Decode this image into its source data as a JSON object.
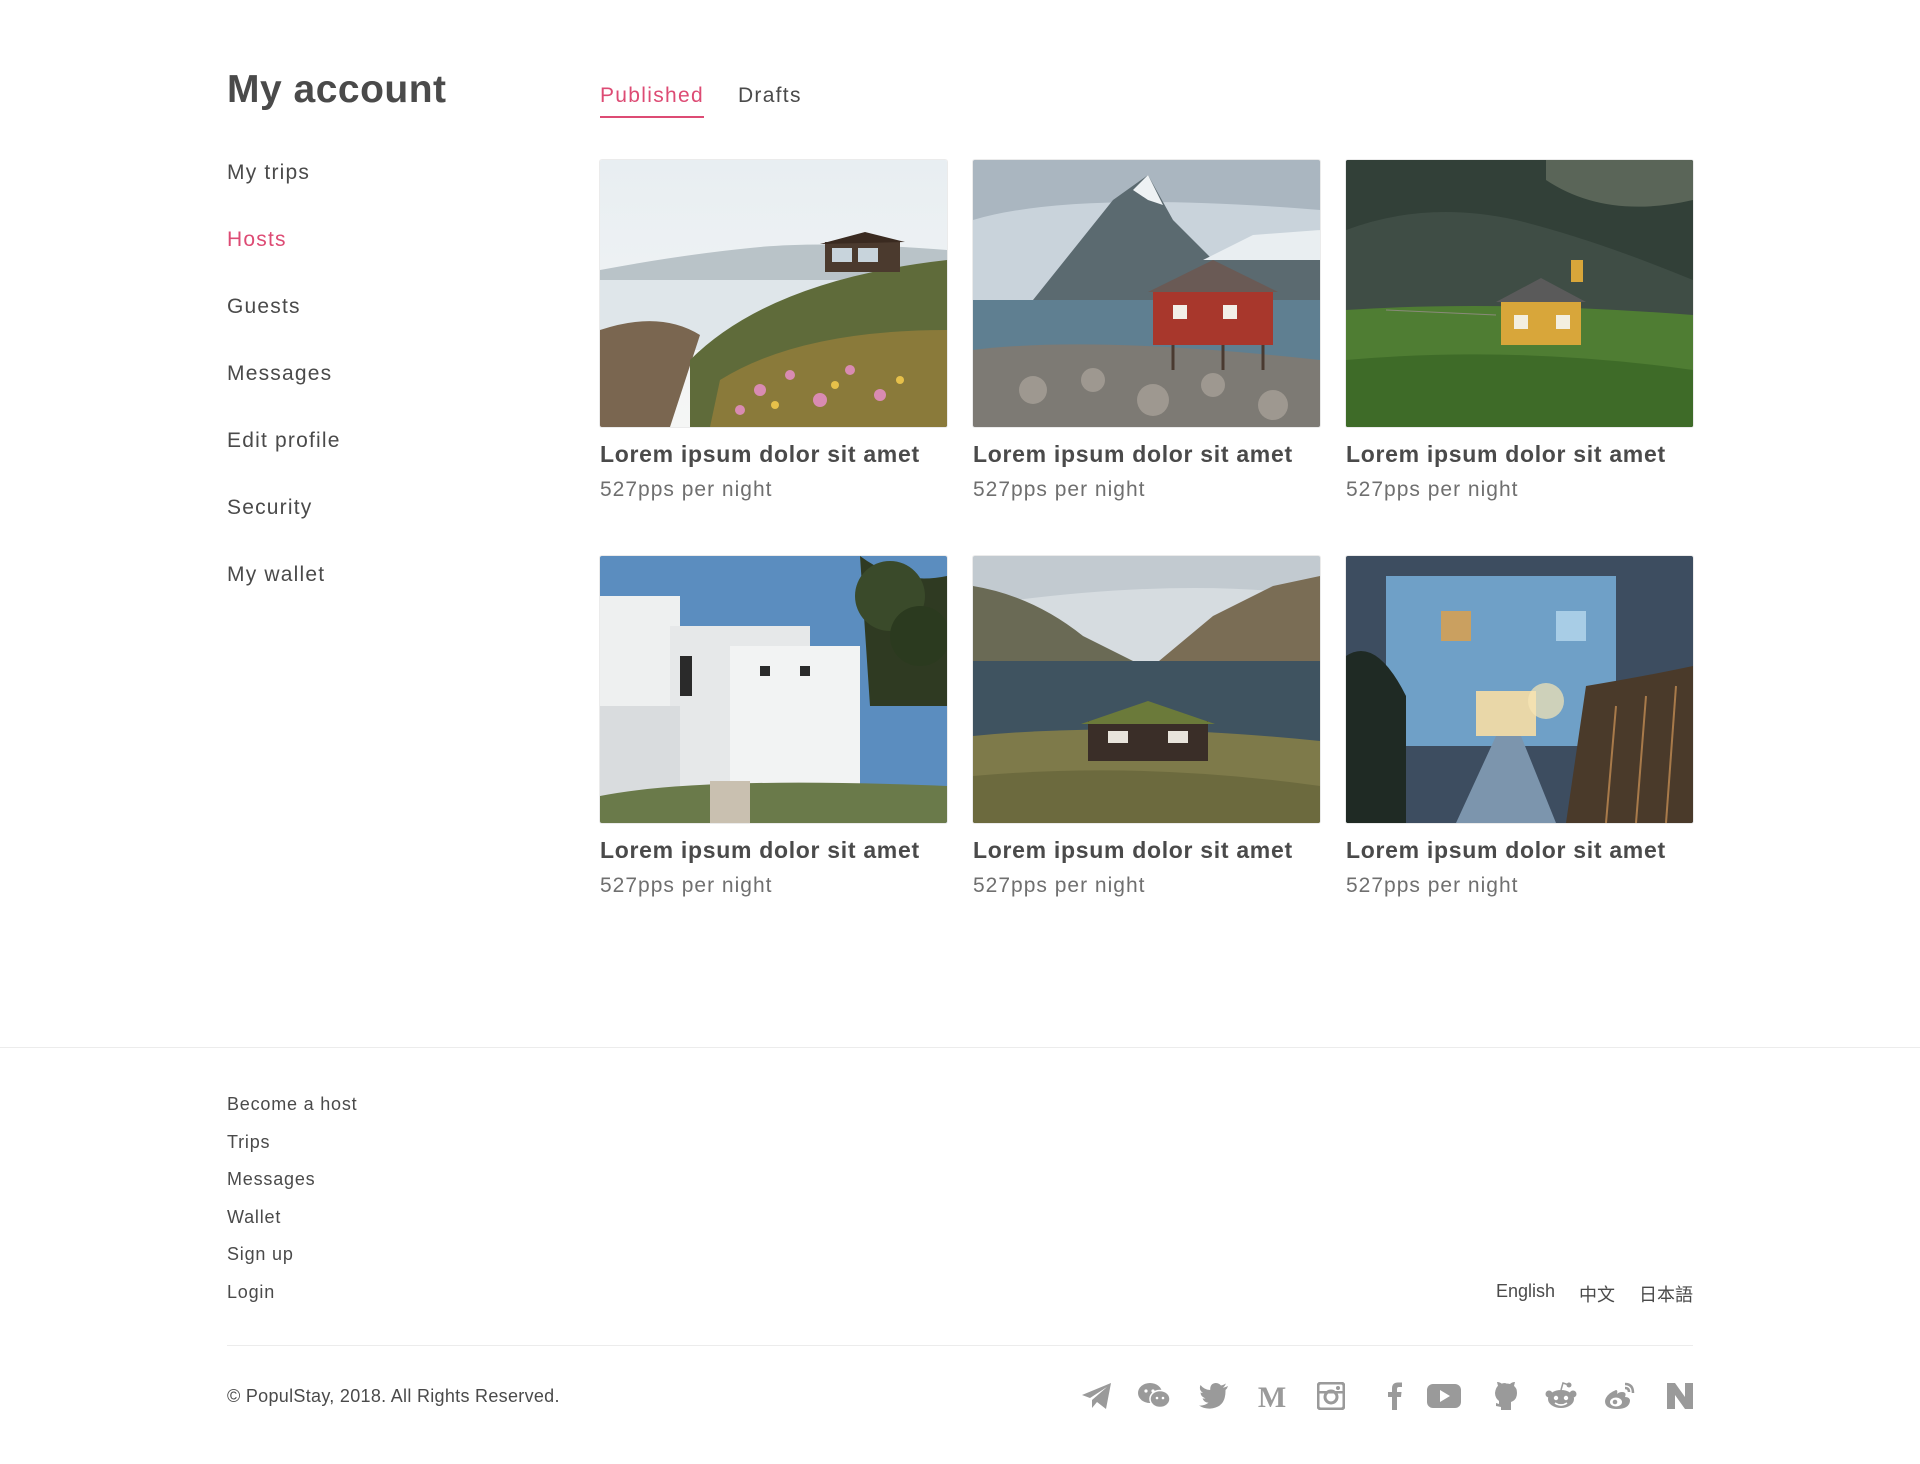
{
  "page_title": "My account",
  "sidebar": {
    "items": [
      {
        "label": "My trips"
      },
      {
        "label": "Hosts",
        "active": true
      },
      {
        "label": "Guests"
      },
      {
        "label": "Messages"
      },
      {
        "label": "Edit profile"
      },
      {
        "label": "Security"
      },
      {
        "label": "My wallet"
      }
    ]
  },
  "tabs": [
    {
      "label": "Published",
      "active": true
    },
    {
      "label": "Drafts"
    }
  ],
  "listings": [
    {
      "title": "Lorem ipsum dolor sit amet",
      "price": "527pps per night",
      "image": "coastal-house"
    },
    {
      "title": "Lorem ipsum dolor sit amet",
      "price": "527pps per night",
      "image": "red-cabin-mountain"
    },
    {
      "title": "Lorem ipsum dolor sit amet",
      "price": "527pps per night",
      "image": "yellow-house-green"
    },
    {
      "title": "Lorem ipsum dolor sit amet",
      "price": "527pps per night",
      "image": "white-modern-house"
    },
    {
      "title": "Lorem ipsum dolor sit amet",
      "price": "527pps per night",
      "image": "turf-roof-cabin-lake"
    },
    {
      "title": "Lorem ipsum dolor sit amet",
      "price": "527pps per night",
      "image": "blue-house-dusk"
    }
  ],
  "footer": {
    "links": [
      "Become a host",
      "Trips",
      "Messages",
      "Wallet",
      "Sign up",
      "Login"
    ],
    "languages": [
      "English",
      "中文",
      "日本語"
    ],
    "copyright": "© PopulStay, 2018. All Rights Reserved.",
    "social": [
      "telegram-icon",
      "wechat-icon",
      "twitter-icon",
      "medium-icon",
      "instagram-icon",
      "facebook-icon",
      "youtube-icon",
      "github-icon",
      "reddit-icon",
      "weibo-icon",
      "neo-icon"
    ]
  },
  "colors": {
    "accent": "#dd4b74",
    "text": "#4a4a4a",
    "muted": "#6f6f6f",
    "icon": "#9a9a9a"
  }
}
